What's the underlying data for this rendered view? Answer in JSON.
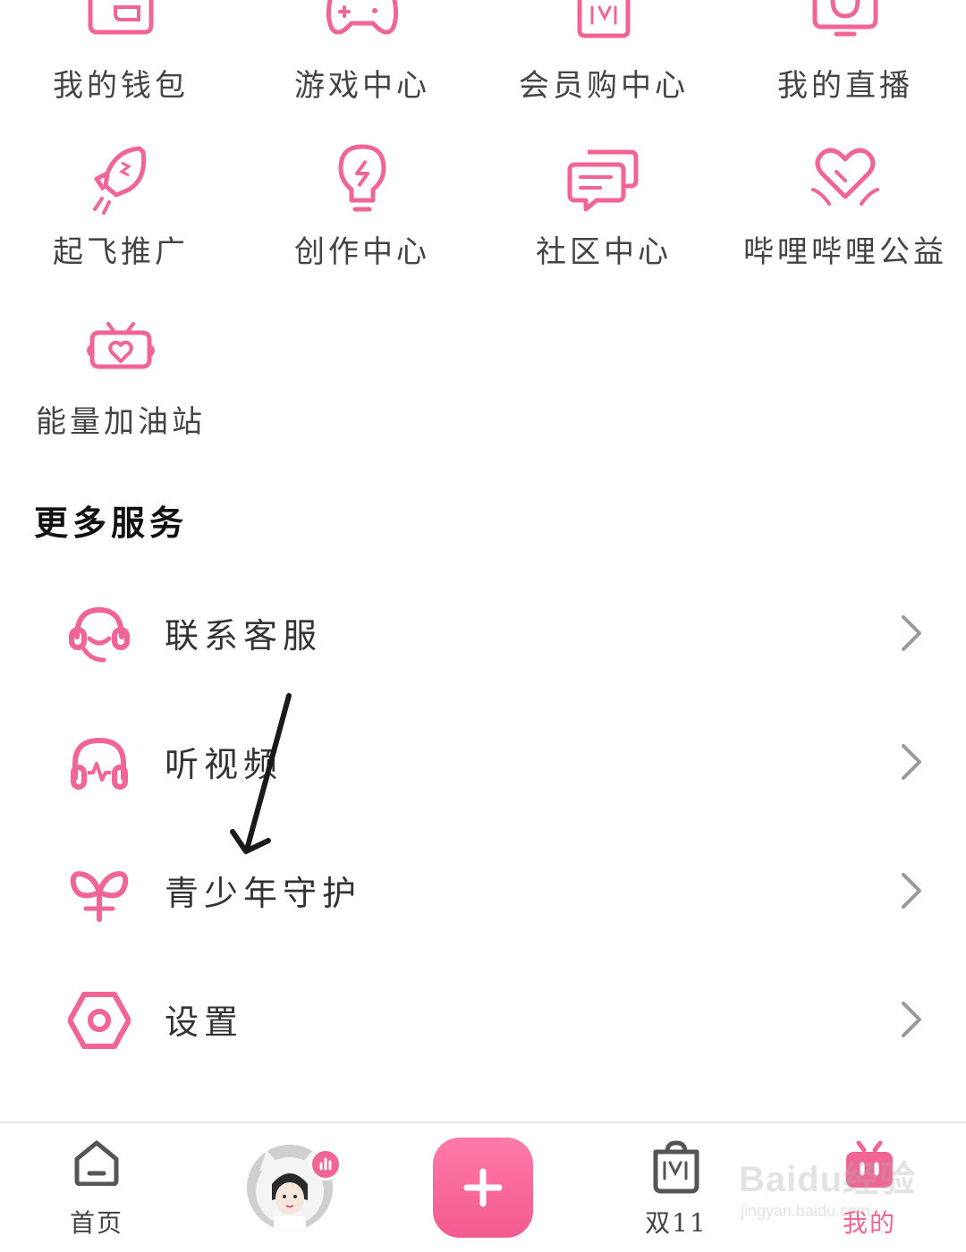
{
  "colors": {
    "accent": "#f06595",
    "text": "#333333",
    "divider": "#e8e8e8"
  },
  "grid": [
    {
      "label": "我的钱包",
      "icon": "wallet-icon"
    },
    {
      "label": "游戏中心",
      "icon": "gamepad-icon"
    },
    {
      "label": "会员购中心",
      "icon": "shopping-bag-icon"
    },
    {
      "label": "我的直播",
      "icon": "live-camera-icon"
    },
    {
      "label": "起飞推广",
      "icon": "rocket-icon"
    },
    {
      "label": "创作中心",
      "icon": "lightbulb-icon"
    },
    {
      "label": "社区中心",
      "icon": "chat-bubbles-icon"
    },
    {
      "label": "哔哩哔哩公益",
      "icon": "heart-hands-icon"
    },
    {
      "label": "能量加油站",
      "icon": "energy-heart-tv-icon"
    }
  ],
  "more_services": {
    "title": "更多服务",
    "items": [
      {
        "label": "联系客服",
        "icon": "headset-service-icon"
      },
      {
        "label": "听视频",
        "icon": "headphones-icon"
      },
      {
        "label": "青少年守护",
        "icon": "sprout-icon"
      },
      {
        "label": "设置",
        "icon": "settings-hexagon-icon"
      }
    ]
  },
  "tabbar": {
    "home": "首页",
    "double11": "双11",
    "mine": "我的"
  },
  "watermark": {
    "line1": "Baidu经验",
    "line2": "jingyan.baidu.com"
  }
}
